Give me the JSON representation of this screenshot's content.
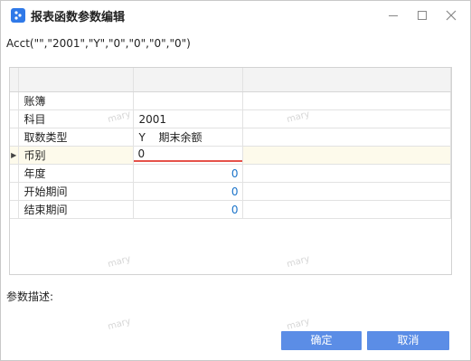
{
  "window": {
    "title": "报表函数参数编辑",
    "icon": "app-dots-icon",
    "accent": "#2f79e8"
  },
  "formula": "Acct(\"\",\"2001\",\"Y\",\"0\",\"0\",\"0\",\"0\")",
  "grid": {
    "rows": [
      {
        "label": "账簿",
        "value": "",
        "extra": ""
      },
      {
        "label": "科目",
        "value": "2001",
        "extra": ""
      },
      {
        "label": "取数类型",
        "value": "Y",
        "extra": "期末余额"
      },
      {
        "label": "币别",
        "value": "0",
        "extra": "",
        "current": true
      },
      {
        "label": "年度",
        "value": "0",
        "extra": ""
      },
      {
        "label": "开始期间",
        "value": "0",
        "extra": ""
      },
      {
        "label": "结束期间",
        "value": "0",
        "extra": ""
      }
    ],
    "current_row_marker": "▶",
    "current_row_color": "#fdfaeb",
    "edit_border_color": "#e5524a"
  },
  "watermark": "mary",
  "description_label": "参数描述:",
  "buttons": {
    "ok": "确定",
    "cancel": "取消",
    "color": "#5b8de6"
  }
}
